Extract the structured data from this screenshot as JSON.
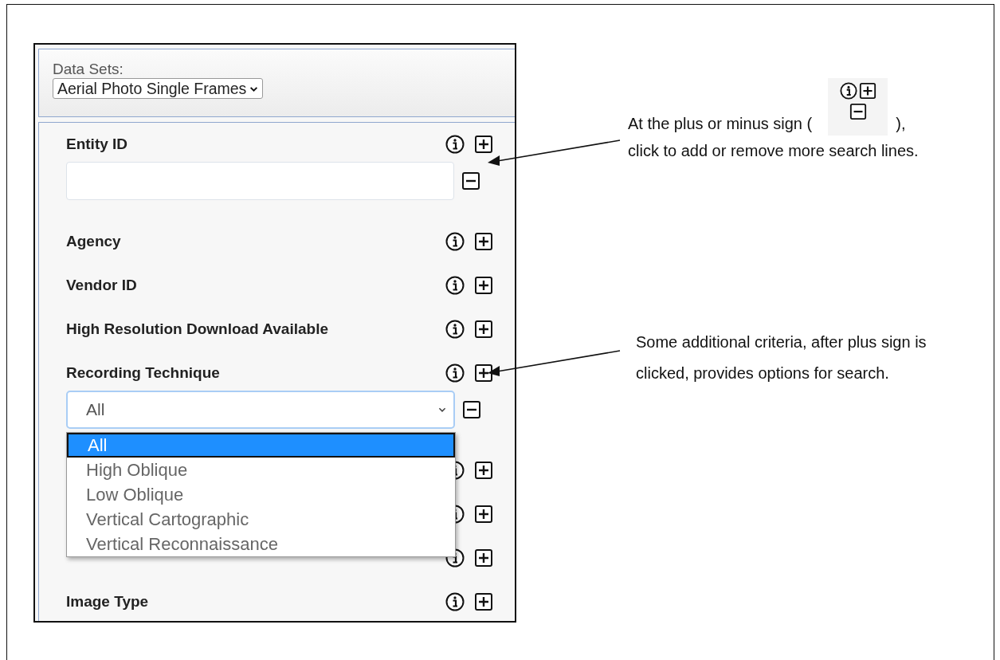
{
  "data_sets": {
    "label": "Data Sets:",
    "value": "Aerial Photo Single Frames"
  },
  "criteria": [
    {
      "kind": "labeled",
      "label": "Entity ID",
      "line": {
        "kind": "text"
      }
    },
    {
      "kind": "labeled",
      "label": "Agency"
    },
    {
      "kind": "labeled",
      "label": "Vendor ID"
    },
    {
      "kind": "labeled",
      "label": "High Resolution Download Available"
    },
    {
      "kind": "labeled",
      "label": "Recording Technique",
      "line": {
        "kind": "select",
        "value": "All",
        "expanded": true,
        "options": [
          {
            "label": "All",
            "selected": true
          },
          {
            "label": "High Oblique",
            "selected": false
          },
          {
            "label": "Low Oblique",
            "selected": false
          },
          {
            "label": "Vertical Cartographic",
            "selected": false
          },
          {
            "label": "Vertical Reconnaissance",
            "selected": false
          }
        ]
      }
    },
    {
      "kind": "covered"
    },
    {
      "kind": "covered"
    },
    {
      "kind": "covered"
    },
    {
      "kind": "labeled",
      "label": "Image Type"
    }
  ],
  "annotations": [
    {
      "kind": "icons",
      "text_before": "At the plus or minus sign (",
      "text_mid": "),",
      "text_after": "click to add or remove more search lines."
    },
    {
      "kind": "plain",
      "text_after": "Some additional criteria, after plus sign is clicked, provides options for search."
    }
  ]
}
